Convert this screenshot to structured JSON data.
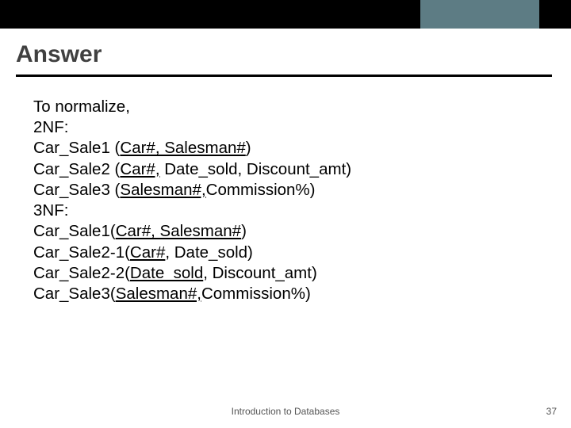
{
  "title": "Answer",
  "body": {
    "l0": "To normalize,",
    "l1": "2NF:",
    "l2a": "Car_Sale1 (",
    "l2b": "Car#, Salesman#",
    "l2c": ")",
    "l3a": "Car_Sale2 (",
    "l3b": "Car#,",
    "l3c": " Date_sold, Discount_amt)",
    "l4a": "Car_Sale3 (",
    "l4b": "Salesman#,",
    "l4c": "Commission%)",
    "l5": "3NF:",
    "l6a": "Car_Sale1(",
    "l6b": "Car#, Salesman#",
    "l6c": ")",
    "l7a": "Car_Sale2-1(",
    "l7b": "Car#",
    "l7c": ", Date_sold)",
    "l8a": "Car_Sale2-2(",
    "l8b": "Date_sold",
    "l8c": ", Discount_amt)",
    "l9a": "Car_Sale3(",
    "l9b": "Salesman#,",
    "l9c": "Commission%)"
  },
  "footer": {
    "center": "Introduction to Databases",
    "page": "37"
  }
}
